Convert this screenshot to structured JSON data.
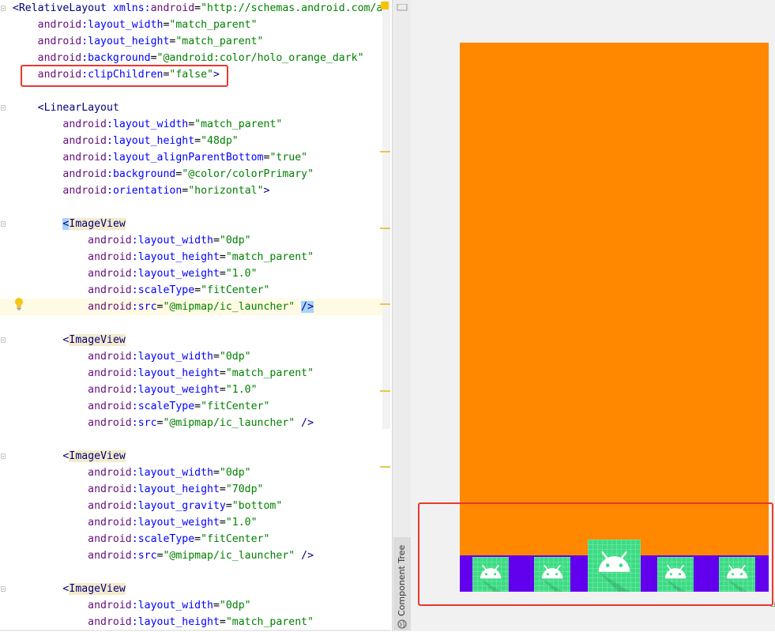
{
  "editor": {
    "lines": [
      [
        [
          "tok-tag",
          "<RelativeLayout "
        ],
        [
          "tok-attr",
          "xmlns:"
        ],
        [
          "tok-ns",
          "android"
        ],
        [
          "tok-plain",
          "="
        ],
        [
          "tok-val",
          "\"http://schemas.android.com/apk"
        ]
      ],
      [
        [
          "tok-plain",
          "    "
        ],
        [
          "tok-ns",
          "android"
        ],
        [
          "tok-attr",
          ":layout_width"
        ],
        [
          "tok-plain",
          "="
        ],
        [
          "tok-val",
          "\"match_parent\""
        ]
      ],
      [
        [
          "tok-plain",
          "    "
        ],
        [
          "tok-ns",
          "android"
        ],
        [
          "tok-attr",
          ":layout_height"
        ],
        [
          "tok-plain",
          "="
        ],
        [
          "tok-val",
          "\"match_parent\""
        ]
      ],
      [
        [
          "tok-plain",
          "    "
        ],
        [
          "tok-ns",
          "android"
        ],
        [
          "tok-attr",
          ":background"
        ],
        [
          "tok-plain",
          "="
        ],
        [
          "tok-val",
          "\"@android:color/holo_orange_dark\""
        ]
      ],
      [
        [
          "tok-plain",
          "    "
        ],
        [
          "tok-ns",
          "android"
        ],
        [
          "tok-attr",
          ":clipChildren"
        ],
        [
          "tok-plain",
          "="
        ],
        [
          "tok-val",
          "\"false\""
        ],
        [
          "tok-tag",
          ">"
        ]
      ],
      [],
      [
        [
          "tok-plain",
          "    "
        ],
        [
          "tok-tag",
          "<LinearLayout"
        ]
      ],
      [
        [
          "tok-plain",
          "        "
        ],
        [
          "tok-ns",
          "android"
        ],
        [
          "tok-attr",
          ":layout_width"
        ],
        [
          "tok-plain",
          "="
        ],
        [
          "tok-val",
          "\"match_parent\""
        ]
      ],
      [
        [
          "tok-plain",
          "        "
        ],
        [
          "tok-ns",
          "android"
        ],
        [
          "tok-attr",
          ":layout_height"
        ],
        [
          "tok-plain",
          "="
        ],
        [
          "tok-val",
          "\"48dp\""
        ]
      ],
      [
        [
          "tok-plain",
          "        "
        ],
        [
          "tok-ns",
          "android"
        ],
        [
          "tok-attr",
          ":layout_alignParentBottom"
        ],
        [
          "tok-plain",
          "="
        ],
        [
          "tok-val",
          "\"true\""
        ]
      ],
      [
        [
          "tok-plain",
          "        "
        ],
        [
          "tok-ns",
          "android"
        ],
        [
          "tok-attr",
          ":background"
        ],
        [
          "tok-plain",
          "="
        ],
        [
          "tok-val",
          "\"@color/colorPrimary\""
        ]
      ],
      [
        [
          "tok-plain",
          "        "
        ],
        [
          "tok-ns",
          "android"
        ],
        [
          "tok-attr",
          ":orientation"
        ],
        [
          "tok-plain",
          "="
        ],
        [
          "tok-val",
          "\"horizontal\""
        ],
        [
          "tok-tag",
          ">"
        ]
      ],
      [],
      [
        [
          "tok-plain",
          "        "
        ],
        [
          "tok-hlclose",
          "<"
        ],
        [
          "tok-hltag",
          "ImageView"
        ]
      ],
      [
        [
          "tok-plain",
          "            "
        ],
        [
          "tok-ns",
          "android"
        ],
        [
          "tok-attr",
          ":layout_width"
        ],
        [
          "tok-plain",
          "="
        ],
        [
          "tok-val",
          "\"0dp\""
        ]
      ],
      [
        [
          "tok-plain",
          "            "
        ],
        [
          "tok-ns",
          "android"
        ],
        [
          "tok-attr",
          ":layout_height"
        ],
        [
          "tok-plain",
          "="
        ],
        [
          "tok-val",
          "\"match_parent\""
        ]
      ],
      [
        [
          "tok-plain",
          "            "
        ],
        [
          "tok-ns",
          "android"
        ],
        [
          "tok-attr",
          ":layout_weight"
        ],
        [
          "tok-plain",
          "="
        ],
        [
          "tok-val",
          "\"1.0\""
        ]
      ],
      [
        [
          "tok-plain",
          "            "
        ],
        [
          "tok-ns",
          "android"
        ],
        [
          "tok-attr",
          ":scaleType"
        ],
        [
          "tok-plain",
          "="
        ],
        [
          "tok-val",
          "\"fitCenter\""
        ]
      ],
      [
        [
          "tok-plain",
          "            "
        ],
        [
          "tok-ns",
          "android"
        ],
        [
          "tok-attr",
          ":src"
        ],
        [
          "tok-plain",
          "="
        ],
        [
          "tok-val",
          "\"@mipmap/ic_launcher\""
        ],
        [
          "tok-plain",
          " "
        ],
        [
          "tok-hlclose",
          "/>"
        ]
      ],
      [],
      [
        [
          "tok-plain",
          "        "
        ],
        [
          "tok-tag",
          "<"
        ],
        [
          "tok-hltag",
          "ImageView"
        ]
      ],
      [
        [
          "tok-plain",
          "            "
        ],
        [
          "tok-ns",
          "android"
        ],
        [
          "tok-attr",
          ":layout_width"
        ],
        [
          "tok-plain",
          "="
        ],
        [
          "tok-val",
          "\"0dp\""
        ]
      ],
      [
        [
          "tok-plain",
          "            "
        ],
        [
          "tok-ns",
          "android"
        ],
        [
          "tok-attr",
          ":layout_height"
        ],
        [
          "tok-plain",
          "="
        ],
        [
          "tok-val",
          "\"match_parent\""
        ]
      ],
      [
        [
          "tok-plain",
          "            "
        ],
        [
          "tok-ns",
          "android"
        ],
        [
          "tok-attr",
          ":layout_weight"
        ],
        [
          "tok-plain",
          "="
        ],
        [
          "tok-val",
          "\"1.0\""
        ]
      ],
      [
        [
          "tok-plain",
          "            "
        ],
        [
          "tok-ns",
          "android"
        ],
        [
          "tok-attr",
          ":scaleType"
        ],
        [
          "tok-plain",
          "="
        ],
        [
          "tok-val",
          "\"fitCenter\""
        ]
      ],
      [
        [
          "tok-plain",
          "            "
        ],
        [
          "tok-ns",
          "android"
        ],
        [
          "tok-attr",
          ":src"
        ],
        [
          "tok-plain",
          "="
        ],
        [
          "tok-val",
          "\"@mipmap/ic_launcher\""
        ],
        [
          "tok-plain",
          " "
        ],
        [
          "tok-tag",
          "/>"
        ]
      ],
      [],
      [
        [
          "tok-plain",
          "        "
        ],
        [
          "tok-tag",
          "<"
        ],
        [
          "tok-hltag",
          "ImageView"
        ]
      ],
      [
        [
          "tok-plain",
          "            "
        ],
        [
          "tok-ns",
          "android"
        ],
        [
          "tok-attr",
          ":layout_width"
        ],
        [
          "tok-plain",
          "="
        ],
        [
          "tok-val",
          "\"0dp\""
        ]
      ],
      [
        [
          "tok-plain",
          "            "
        ],
        [
          "tok-ns",
          "android"
        ],
        [
          "tok-attr",
          ":layout_height"
        ],
        [
          "tok-plain",
          "="
        ],
        [
          "tok-val",
          "\"70dp\""
        ]
      ],
      [
        [
          "tok-plain",
          "            "
        ],
        [
          "tok-ns",
          "android"
        ],
        [
          "tok-attr",
          ":layout_gravity"
        ],
        [
          "tok-plain",
          "="
        ],
        [
          "tok-val",
          "\"bottom\""
        ]
      ],
      [
        [
          "tok-plain",
          "            "
        ],
        [
          "tok-ns",
          "android"
        ],
        [
          "tok-attr",
          ":layout_weight"
        ],
        [
          "tok-plain",
          "="
        ],
        [
          "tok-val",
          "\"1.0\""
        ]
      ],
      [
        [
          "tok-plain",
          "            "
        ],
        [
          "tok-ns",
          "android"
        ],
        [
          "tok-attr",
          ":scaleType"
        ],
        [
          "tok-plain",
          "="
        ],
        [
          "tok-val",
          "\"fitCenter\""
        ]
      ],
      [
        [
          "tok-plain",
          "            "
        ],
        [
          "tok-ns",
          "android"
        ],
        [
          "tok-attr",
          ":src"
        ],
        [
          "tok-plain",
          "="
        ],
        [
          "tok-val",
          "\"@mipmap/ic_launcher\""
        ],
        [
          "tok-plain",
          " "
        ],
        [
          "tok-tag",
          "/>"
        ]
      ],
      [],
      [
        [
          "tok-plain",
          "        "
        ],
        [
          "tok-tag",
          "<"
        ],
        [
          "tok-hltag",
          "ImageView"
        ]
      ],
      [
        [
          "tok-plain",
          "            "
        ],
        [
          "tok-ns",
          "android"
        ],
        [
          "tok-attr",
          ":layout_width"
        ],
        [
          "tok-plain",
          "="
        ],
        [
          "tok-val",
          "\"0dp\""
        ]
      ],
      [
        [
          "tok-plain",
          "            "
        ],
        [
          "tok-ns",
          "android"
        ],
        [
          "tok-attr",
          ":layout_height"
        ],
        [
          "tok-plain",
          "="
        ],
        [
          "tok-val",
          "\"match_parent\""
        ]
      ]
    ],
    "highlighted_line": 18
  },
  "side_panel": {
    "component_tree_label": "Component Tree",
    "icons": [
      "globe-icon",
      "strip-icon"
    ]
  },
  "preview": {
    "colors": {
      "screen_background": "#ff8800",
      "bottom_bar": "#6200ee",
      "launcher_background": "#3ddc84",
      "highlight": "#e8392f"
    },
    "launcher_icons": [
      "android-launcher-icon-1",
      "android-launcher-icon-2",
      "android-launcher-icon-3",
      "android-launcher-icon-4",
      "android-launcher-icon-5"
    ]
  }
}
